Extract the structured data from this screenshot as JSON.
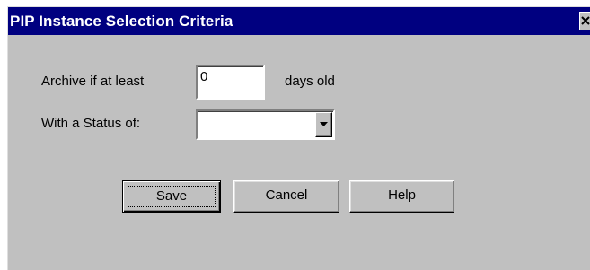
{
  "window": {
    "title": "PIP Instance Selection Criteria",
    "close_icon": "close-icon"
  },
  "form": {
    "archive_label": "Archive if at least",
    "archive_value": "0",
    "days_suffix": "days old",
    "status_label": "With a Status of:",
    "status_value": ""
  },
  "buttons": {
    "save": "Save",
    "cancel": "Cancel",
    "help": "Help"
  }
}
